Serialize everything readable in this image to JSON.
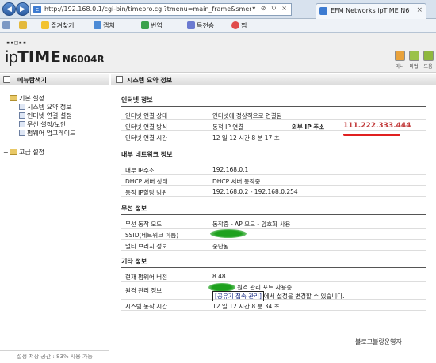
{
  "browser": {
    "url": "http://192.168.0.1/cgi-bin/timepro.cgi?tmenu=main_frame&smenu=main_frame",
    "url_controls": "▾ ⊘ ↻ ×",
    "tab_title": "EFM Networks ipTIME N60...",
    "toolbar": [
      "즐겨찾기",
      "캡쳐",
      "번역",
      "독전송",
      "찜"
    ]
  },
  "header": {
    "logo_ip": "ip",
    "logo_time": "TIME",
    "logo_model": "N6004R",
    "icons": [
      {
        "name": "minimize-icon",
        "label": "미니",
        "color": "#e9a23b"
      },
      {
        "name": "wizard-icon",
        "label": "마법",
        "color": "#9bc24a"
      },
      {
        "name": "help-icon",
        "label": "도움",
        "color": "#8fb83e"
      }
    ]
  },
  "left_panel": {
    "title": "메뉴탐색기",
    "basic_settings": "기본 설정",
    "items": [
      "시스템 요약 정보",
      "인터넷 연결 설정",
      "무선 설정/보안",
      "펌웨어 업그레이드"
    ],
    "advanced_settings": "고급 설정",
    "footer": "설정 저장 공간 : 83% 사용 가능"
  },
  "main": {
    "title": "시스템 요약 정보",
    "internet": {
      "section": "인터넷 정보",
      "status_label": "인터넷 연결 상태",
      "status_value": "인터넷에 정상적으로 연결됨",
      "method_label": "인터넷 연결 방식",
      "method_value": "동적 IP 연결",
      "external_ip_label": "외부 IP 주소",
      "external_ip_value": "111.222.333.444",
      "time_label": "인터넷 연결 시간",
      "time_value": "12 일 12 시간 8 분 17 초"
    },
    "lan": {
      "section": "내부 네트워크 정보",
      "ip_label": "내부 IP주소",
      "ip_value": "192.168.0.1",
      "dhcp_label": "DHCP 서버 상태",
      "dhcp_value": "DHCP 서버 동작중",
      "range_label": "동적 IP할당 범위",
      "range_value": "192.168.0.2 - 192.168.0.254"
    },
    "wireless": {
      "section": "무선 정보",
      "mode_label": "무선 동작 모드",
      "mode_value": "동작중 - AP 모드 - 암호화 사용",
      "ssid_label": "SSID(네트워크 이름)",
      "bridge_label": "멀티 브리지 정보",
      "bridge_value": "중단됨"
    },
    "other": {
      "section": "기타 정보",
      "firmware_label": "현재 펌웨어 버전",
      "firmware_value": "8.48",
      "remote_label": "원격 관리 정보",
      "remote_value": "원격 관리 포트 사용중",
      "remote_link": "[공유기 접속 관리]",
      "remote_suffix": "에서 설정을 변경할 수 있습니다.",
      "uptime_label": "시스템 동작 시간",
      "uptime_value": "12 일 12 시간 8 분 34 초"
    },
    "footer": "블로그블랑운영자"
  }
}
